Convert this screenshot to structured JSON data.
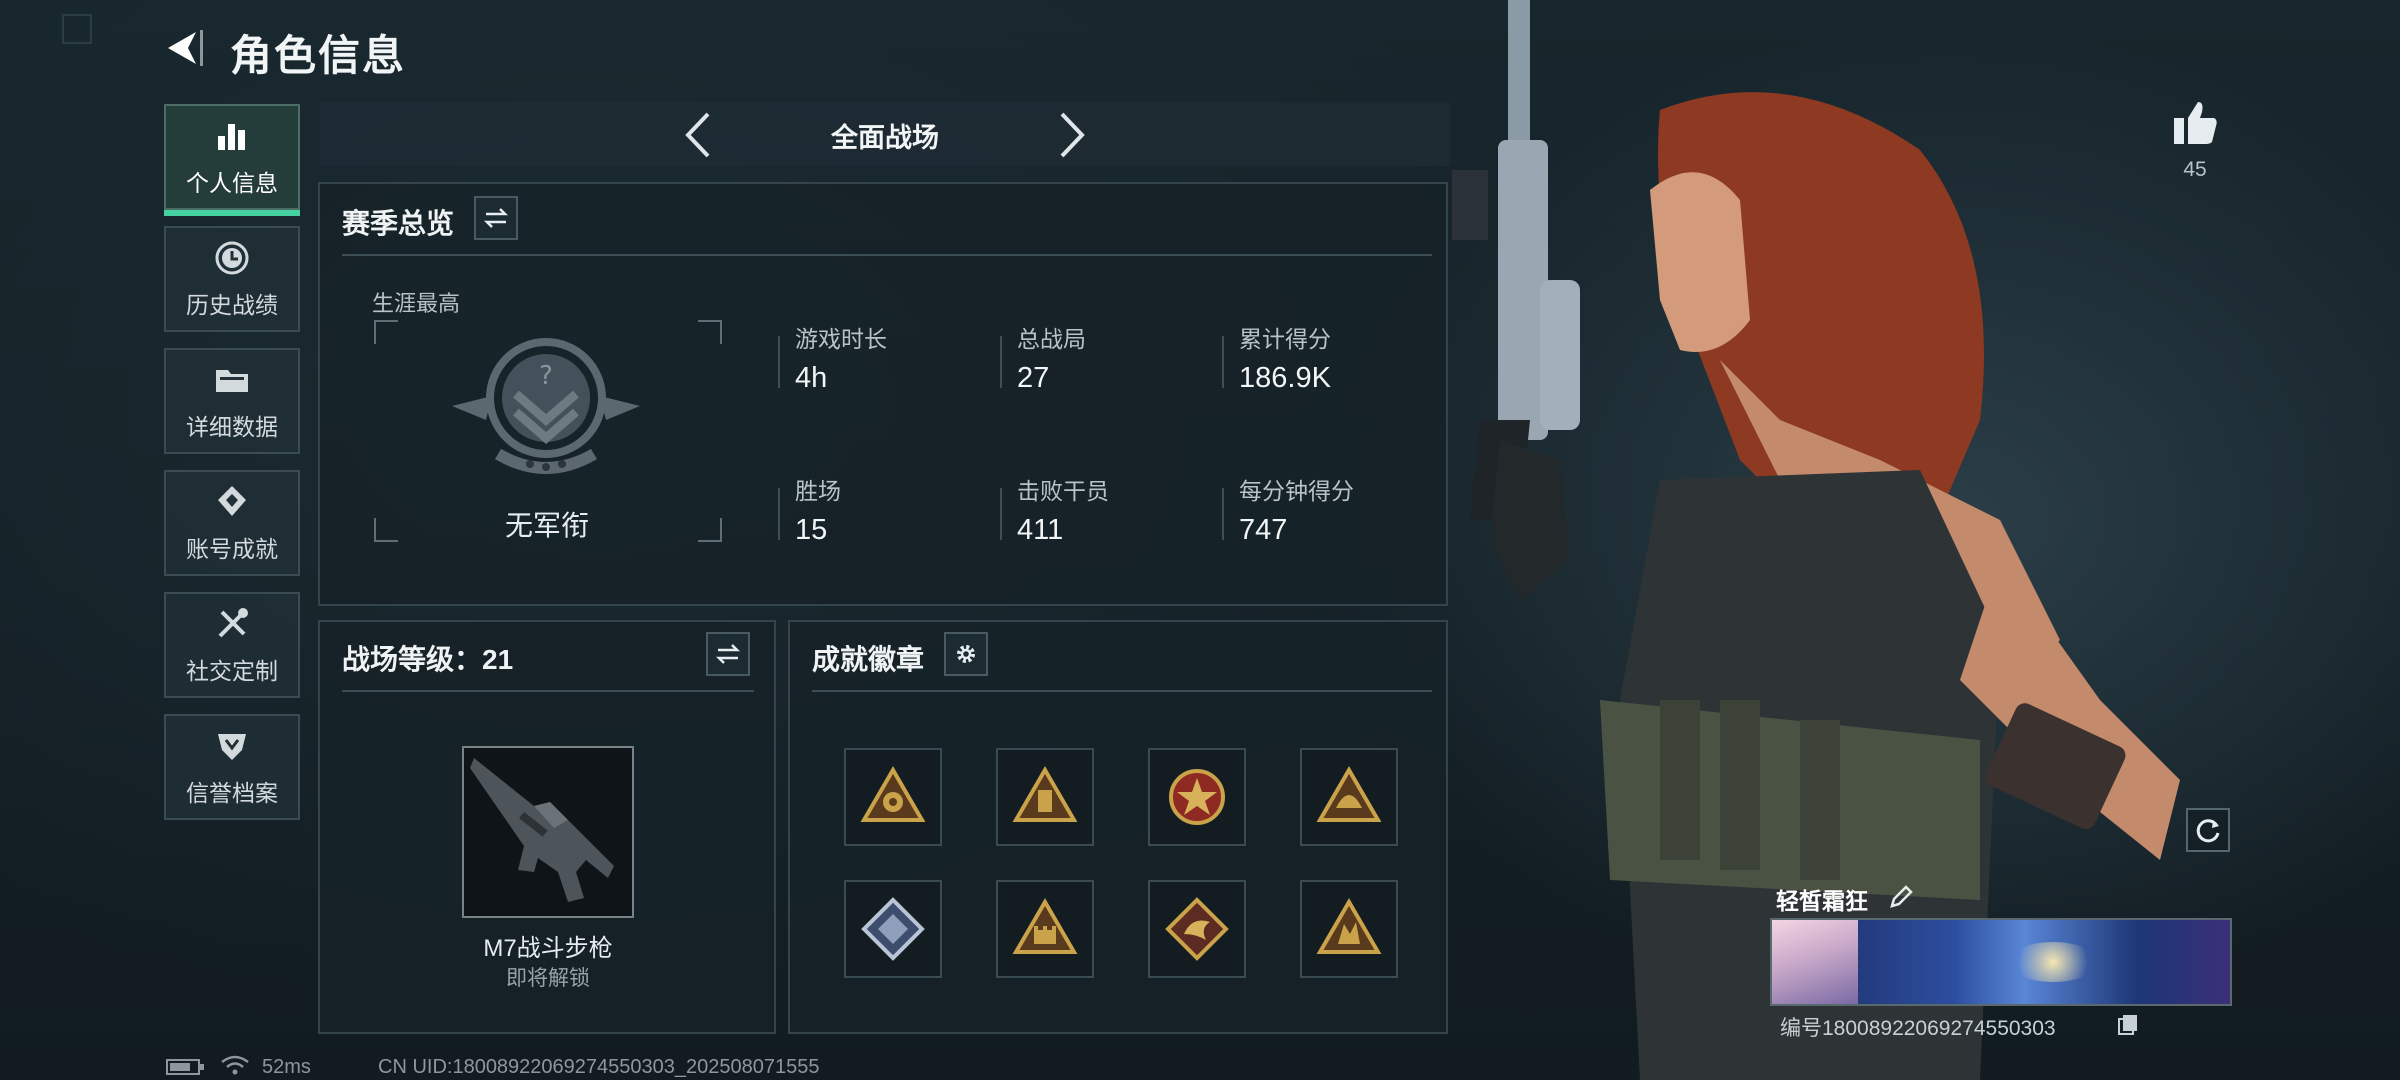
{
  "header": {
    "title": "角色信息"
  },
  "sidebar": {
    "items": [
      {
        "label": "个人信息",
        "icon": "bar-chart-icon",
        "active": true
      },
      {
        "label": "历史战绩",
        "icon": "clock-icon"
      },
      {
        "label": "详细数据",
        "icon": "folder-icon"
      },
      {
        "label": "账号成就",
        "icon": "achievement-icon"
      },
      {
        "label": "社交定制",
        "icon": "tools-icon"
      },
      {
        "label": "信誉档案",
        "icon": "shield-rank-icon"
      }
    ]
  },
  "mode": {
    "title": "全面战场"
  },
  "season": {
    "title": "赛季总览",
    "career_label": "生涯最高",
    "rank_name": "无军衔",
    "stats": [
      {
        "label": "游戏时长",
        "value": "4h"
      },
      {
        "label": "总战局",
        "value": "27"
      },
      {
        "label": "累计得分",
        "value": "186.9K"
      },
      {
        "label": "胜场",
        "value": "15"
      },
      {
        "label": "击败干员",
        "value": "411"
      },
      {
        "label": "每分钟得分",
        "value": "747"
      }
    ]
  },
  "battlefield_level": {
    "title": "战场等级：21",
    "weapon_name": "M7战斗步枪",
    "weapon_status": "即将解锁"
  },
  "badges": {
    "title": "成就徽章",
    "items": [
      {
        "icon": "badge-triangle-eye-icon"
      },
      {
        "icon": "badge-triangle-tower-icon"
      },
      {
        "icon": "badge-red-star-emblem-icon"
      },
      {
        "icon": "badge-triangle-helmet-icon"
      },
      {
        "icon": "badge-blue-diamond-icon"
      },
      {
        "icon": "badge-triangle-castle-icon"
      },
      {
        "icon": "badge-dragon-diamond-icon"
      },
      {
        "icon": "badge-triangle-beast-icon"
      }
    ]
  },
  "likes": {
    "count": "45"
  },
  "player_card": {
    "name": "轻皙霜狂",
    "id_text": "编号18008922069274550303"
  },
  "status_bar": {
    "ping": "52ms",
    "uid_text": "CN UID:18008922069274550303_202508071555"
  },
  "colors": {
    "accent": "#45d1a0",
    "gold": "#c9a24a",
    "panel_bg": "#16222a"
  }
}
